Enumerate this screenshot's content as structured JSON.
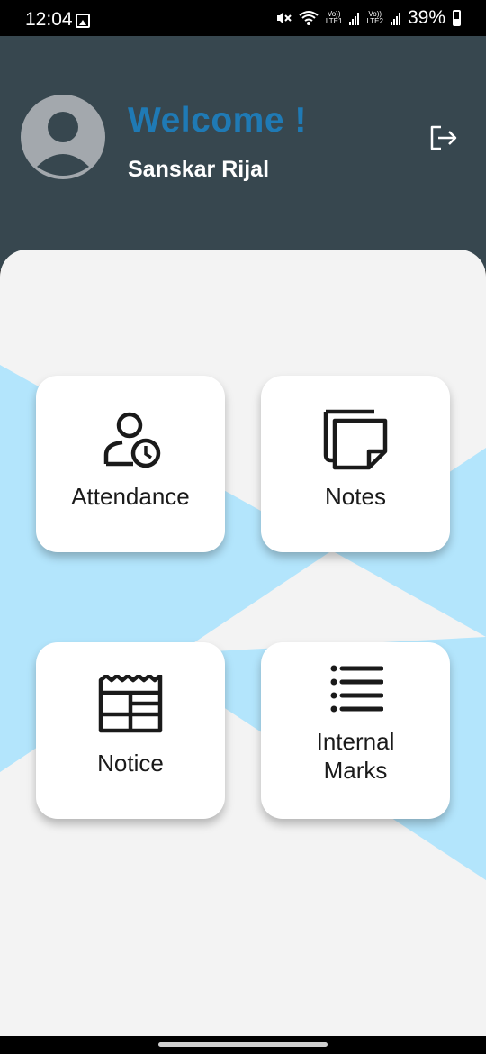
{
  "status_bar": {
    "time": "12:04",
    "battery": "39%",
    "icons": [
      "gallery-icon",
      "mute-icon",
      "wifi-icon",
      "volte-lte1-icon",
      "signal-icon",
      "volte-lte2-icon",
      "signal-icon",
      "battery-icon"
    ],
    "lte1": "LTE1",
    "lte2": "LTE2",
    "volte": "Vo))"
  },
  "header": {
    "welcome": "Welcome !",
    "username": "Sanskar Rijal",
    "avatar_icon": "user-avatar-icon",
    "logout_icon": "logout-icon"
  },
  "menu": {
    "attendance": {
      "label": "Attendance",
      "icon": "person-clock-icon"
    },
    "notes": {
      "label": "Notes",
      "icon": "sticky-notes-icon"
    },
    "notice": {
      "label": "Notice",
      "icon": "newspaper-icon"
    },
    "internal_marks": {
      "label_line1": "Internal",
      "label_line2": "Marks",
      "icon": "list-icon"
    }
  },
  "colors": {
    "header_bg": "#37474f",
    "welcome_text": "#1f7ab5",
    "content_bg": "#f3f3f3",
    "accent_shape": "#b3e5fc",
    "card_bg": "#ffffff"
  }
}
